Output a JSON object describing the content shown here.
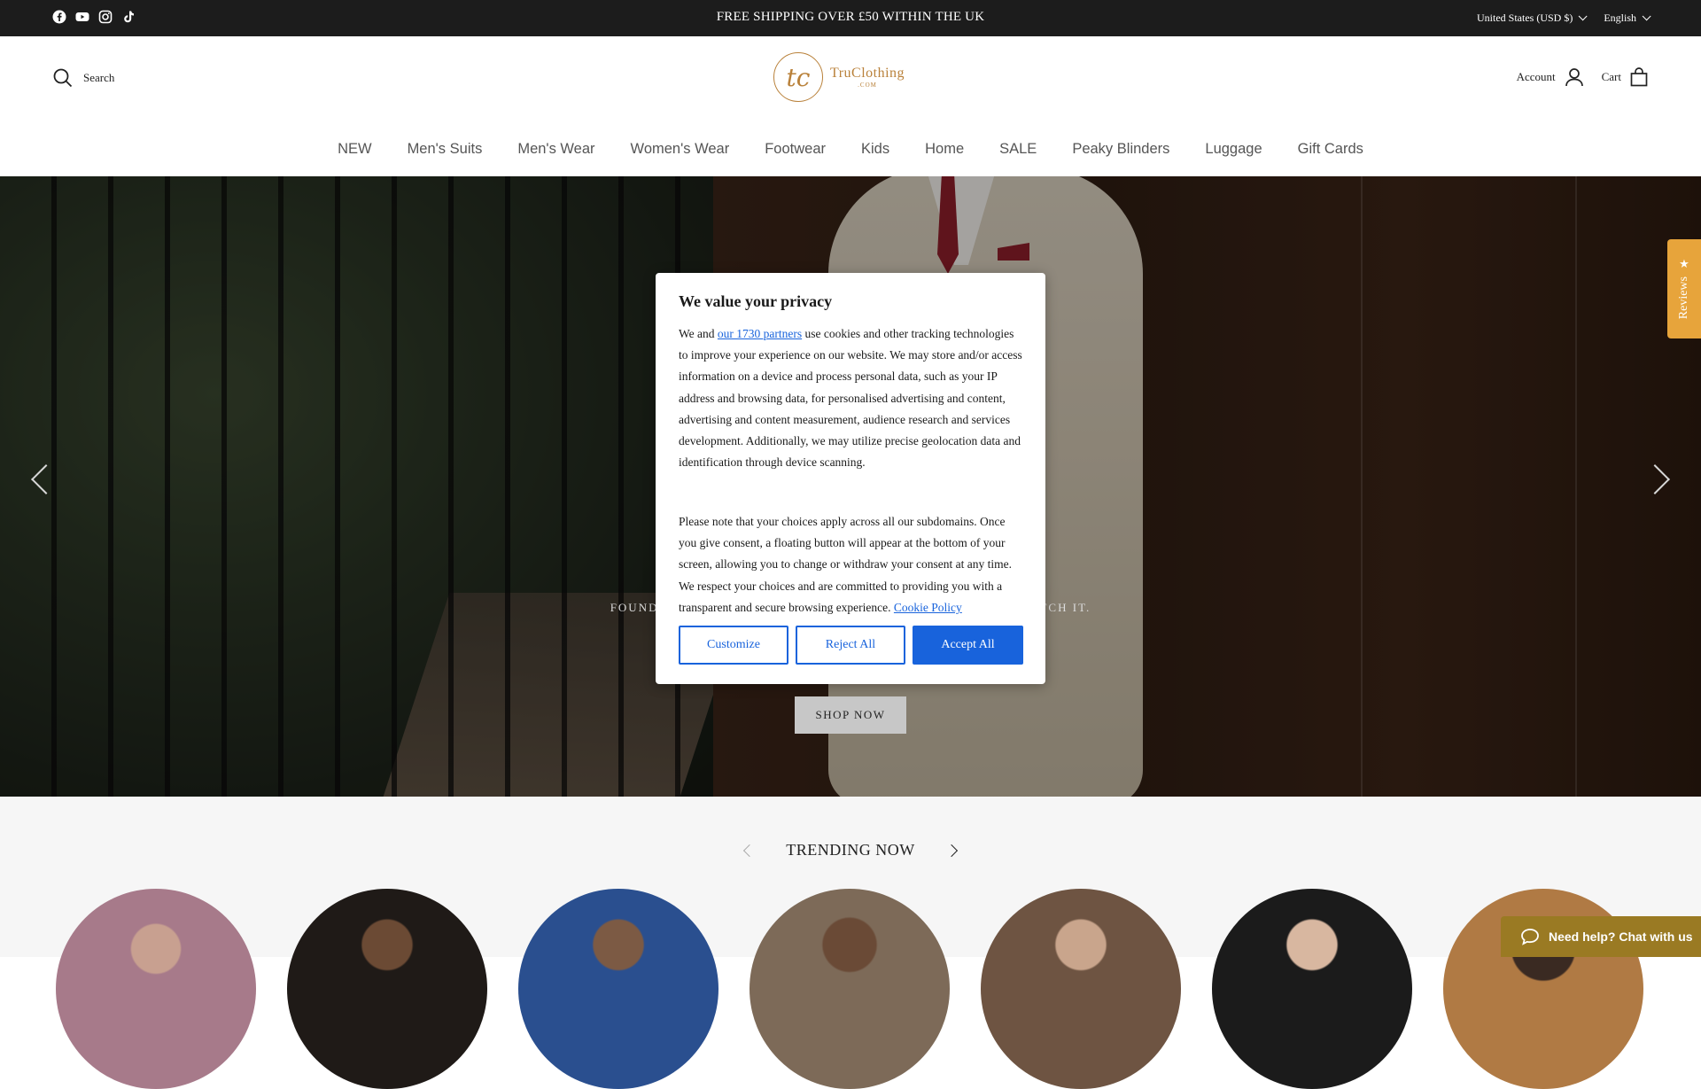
{
  "topbar": {
    "announcement": "FREE SHIPPING OVER £50 WITHIN THE UK",
    "socials": [
      "facebook-icon",
      "youtube-icon",
      "instagram-icon",
      "tiktok-icon"
    ],
    "country": "United States (USD $)",
    "language": "English"
  },
  "header": {
    "search_label": "Search",
    "logo_mark": "tc",
    "logo_word": "TruClothing",
    "logo_sub": ".COM",
    "account_label": "Account",
    "cart_label": "Cart"
  },
  "nav": {
    "items": [
      "NEW",
      "Men's Suits",
      "Men's Wear",
      "Women's Wear",
      "Footwear",
      "Kids",
      "Home",
      "SALE",
      "Peaky Blinders",
      "Luggage",
      "Gift Cards"
    ]
  },
  "hero": {
    "tagline_left": "FOUND",
    "tagline_right": "TCH IT.",
    "shop_label": "SHOP NOW"
  },
  "reviews": {
    "label": "Reviews",
    "star": "★"
  },
  "consent": {
    "title": "We value your privacy",
    "p1_before": "We and ",
    "p1_link": "our 1730 partners",
    "p1_after": " use cookies and other tracking technologies to improve your experience on our website. We may store and/or access information on a device and process personal data, such as your IP address and browsing data, for personalised advertising and content, advertising and content measurement, audience research and services development. Additionally, we may utilize precise geolocation data and identification through device scanning.",
    "p2": "Please note that your choices apply across all our subdomains. Once you give consent, a floating button will appear at the bottom of your screen, allowing you to change or withdraw your consent at any time. We respect your choices and are committed to providing you with a transparent and secure browsing experience. ",
    "p2_link": "Cookie Policy",
    "customize": "Customize",
    "reject": "Reject All",
    "accept": "Accept All",
    "accent": "#1863dc"
  },
  "trending": {
    "title": "TRENDING NOW"
  },
  "chat": {
    "label": "Need help? Chat with us"
  }
}
